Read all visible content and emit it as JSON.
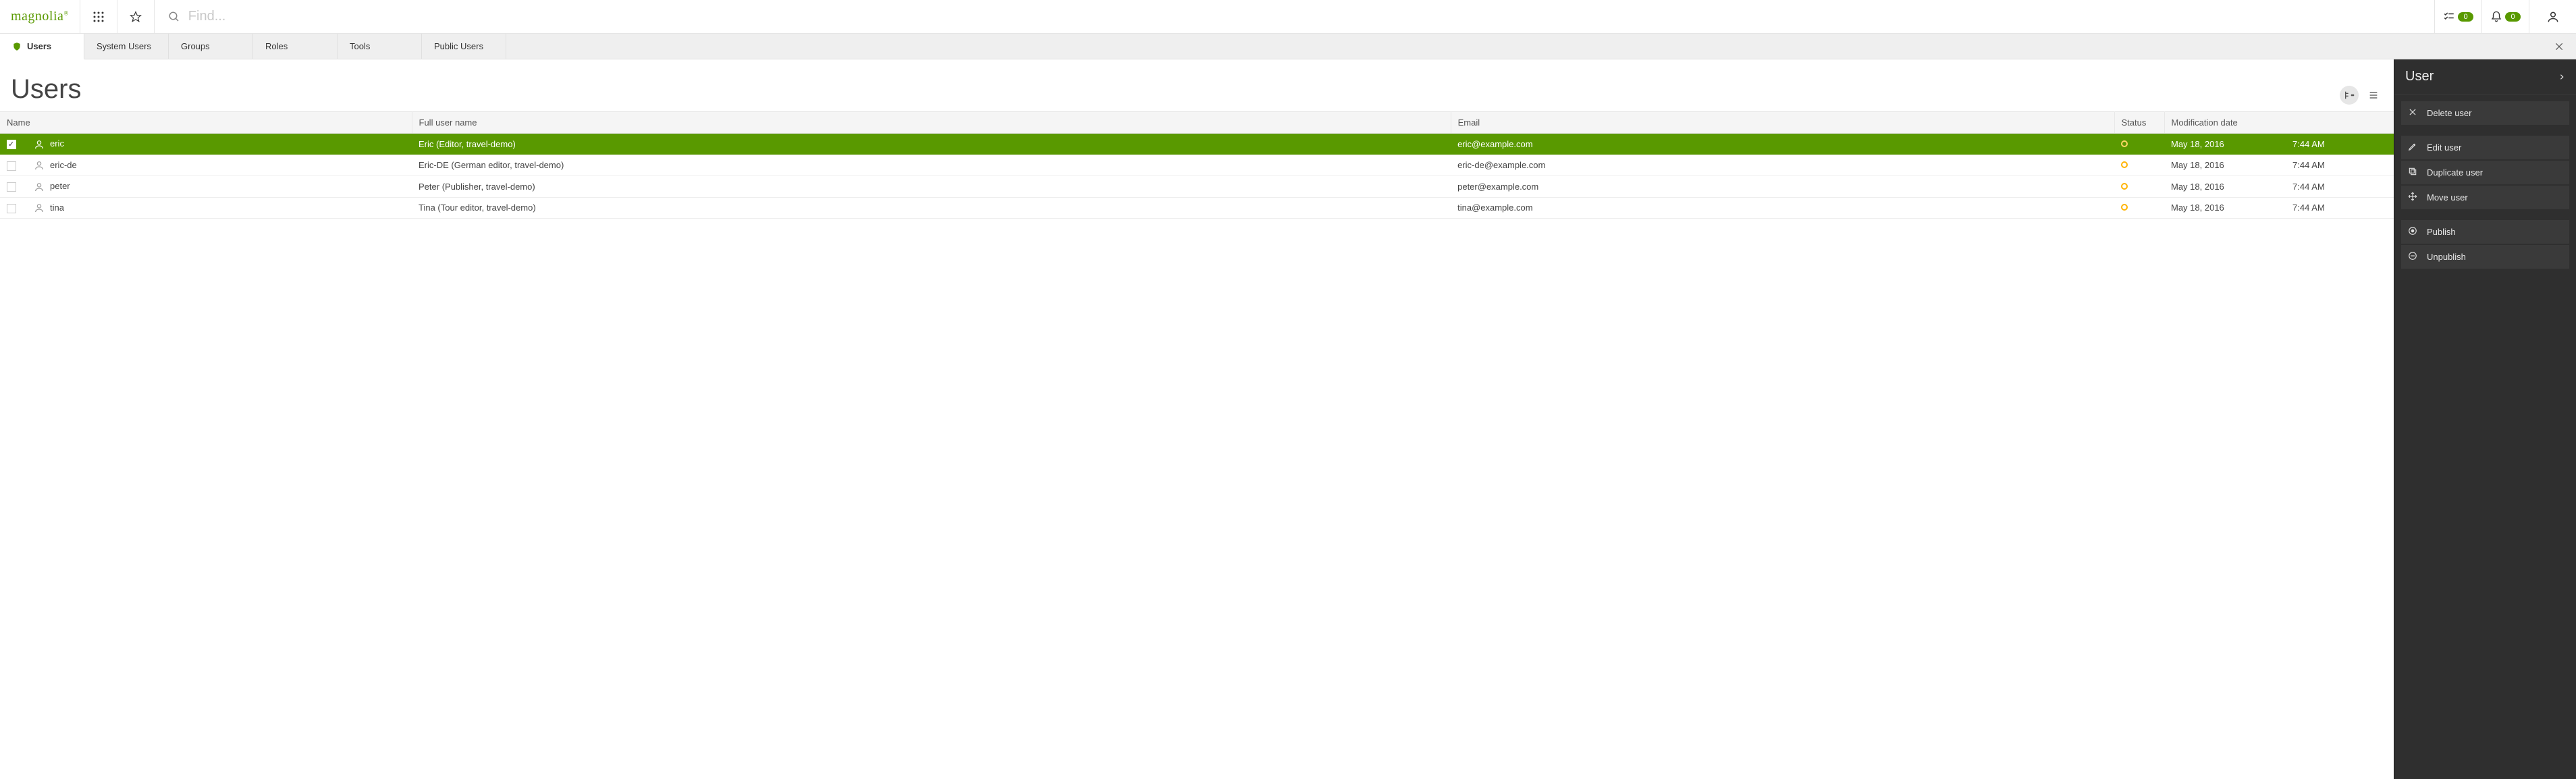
{
  "brand": {
    "name": "magnolia"
  },
  "search": {
    "placeholder": "Find..."
  },
  "header_badges": {
    "tasks": "0",
    "notifications": "0"
  },
  "tabs": [
    {
      "label": "Users",
      "active": true
    },
    {
      "label": "System Users",
      "active": false
    },
    {
      "label": "Groups",
      "active": false
    },
    {
      "label": "Roles",
      "active": false
    },
    {
      "label": "Tools",
      "active": false
    },
    {
      "label": "Public Users",
      "active": false
    }
  ],
  "page": {
    "title": "Users"
  },
  "columns": {
    "name": "Name",
    "full_name": "Full user name",
    "email": "Email",
    "status": "Status",
    "mod_date": "Modification date"
  },
  "rows": [
    {
      "selected": true,
      "name": "eric",
      "full_name": "Eric (Editor, travel-demo)",
      "email": "eric@example.com",
      "date": "May 18, 2016",
      "time": "7:44 AM"
    },
    {
      "selected": false,
      "name": "eric-de",
      "full_name": "Eric-DE (German editor, travel-demo)",
      "email": "eric-de@example.com",
      "date": "May 18, 2016",
      "time": "7:44 AM"
    },
    {
      "selected": false,
      "name": "peter",
      "full_name": "Peter (Publisher, travel-demo)",
      "email": "peter@example.com",
      "date": "May 18, 2016",
      "time": "7:44 AM"
    },
    {
      "selected": false,
      "name": "tina",
      "full_name": "Tina (Tour editor, travel-demo)",
      "email": "tina@example.com",
      "date": "May 18, 2016",
      "time": "7:44 AM"
    }
  ],
  "panel": {
    "title": "User",
    "actions_group1": [
      {
        "icon": "close",
        "label": "Delete user"
      }
    ],
    "actions_group2": [
      {
        "icon": "pencil",
        "label": "Edit user"
      },
      {
        "icon": "duplicate",
        "label": "Duplicate user"
      },
      {
        "icon": "move",
        "label": "Move user"
      }
    ],
    "actions_group3": [
      {
        "icon": "publish",
        "label": "Publish"
      },
      {
        "icon": "unpublish",
        "label": "Unpublish"
      }
    ]
  }
}
